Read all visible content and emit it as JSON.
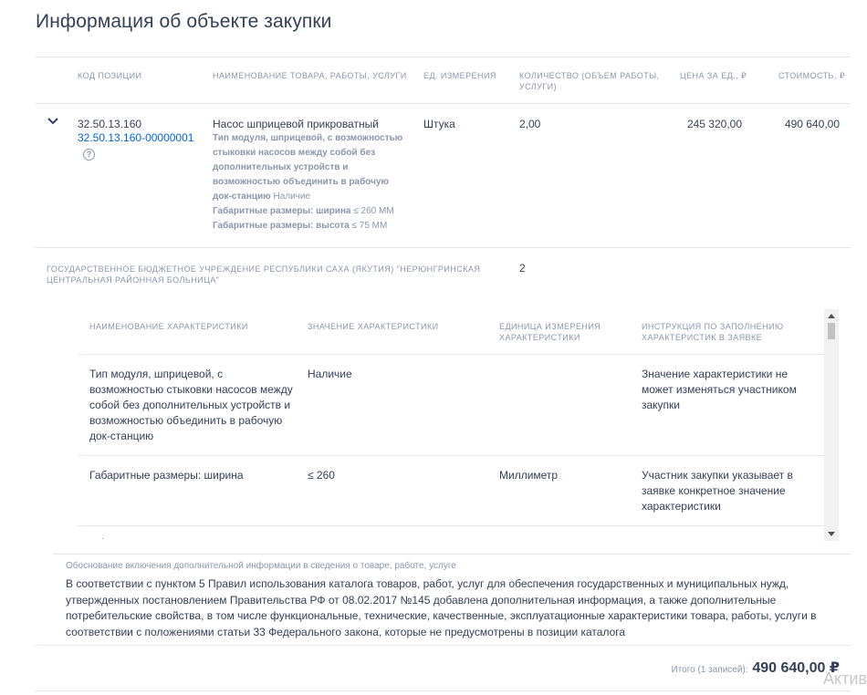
{
  "page": {
    "title": "Информация об объекте закупки"
  },
  "table": {
    "headers": {
      "code": "Код позиции",
      "name": "Наименование товара, работы, услуги",
      "unit": "Ед. измерения",
      "qty": "Количество (объем работы, услуги)",
      "price": "Цена за ед., ₽",
      "cost": "Стоимость, ₽"
    },
    "row": {
      "code": "32.50.13.160",
      "code_full": "32.50.13.160-00000001",
      "help_icon": "?",
      "name": "Насос шприцевой прикроватный",
      "attrs": [
        {
          "label": "Тип модуля, шприцевой, с возможностью стыковки насосов между собой без дополнительных устройств и возможностью объединить в рабочую док-станцию",
          "value": "Наличие"
        },
        {
          "label": "Габаритные размеры: ширина",
          "value": "≤ 260 ММ"
        },
        {
          "label": "Габаритные размеры: высота",
          "value": "≤ 75 ММ"
        }
      ],
      "unit": "Штука",
      "qty": "2,00",
      "price": "245 320,00",
      "cost": "490 640,00"
    },
    "customer": {
      "name": "Государственное бюджетное учреждение Республики Саха (Якутия) \"Нерюнгринская центральная районная больница\"",
      "qty": "2"
    }
  },
  "characteristics": {
    "headers": {
      "name": "Наименование характеристики",
      "value": "Значение характеристики",
      "unit": "Единица измерения характеристики",
      "instruction": "Инструкция по заполнению характеристик в заявке"
    },
    "rows": [
      {
        "name": "Тип модуля, шприцевой, с возможностью стыковки насосов между собой без дополнительных устройств и возможностью объединить в рабочую док-станцию",
        "value": "Наличие",
        "unit": "",
        "instruction": "Значение характеристики не может изменяться участником закупки"
      },
      {
        "name": "Габаритные размеры: ширина",
        "value": "≤ 260",
        "unit": "Миллиметр",
        "instruction": "Участник закупки указывает в заявке конкретное значение характеристики"
      }
    ],
    "partial_row_glyph": "."
  },
  "justification": {
    "label": "Обоснование включения дополнительной информации в сведения о товаре, работе, услуге",
    "text": "В соответствии с пунктом 5 Правил использования каталога товаров, работ, услуг для обеспечения государственных и муниципальных нужд, утвержденных постановлением Правительства РФ от 08.02.2017 №145 добавлена дополнительная информация, а также дополнительные потребительские свойства, в том числе функциональные, технические, качественные, эксплуатационные характеристики товара, работы, услуги в соответствии с положениями статьи 33 Федерального закона, которые не предусмотрены в позиции каталога"
  },
  "total": {
    "label": "Итого (1 записей):",
    "value": "490 640,00 ₽"
  },
  "watermark": "Активация"
}
